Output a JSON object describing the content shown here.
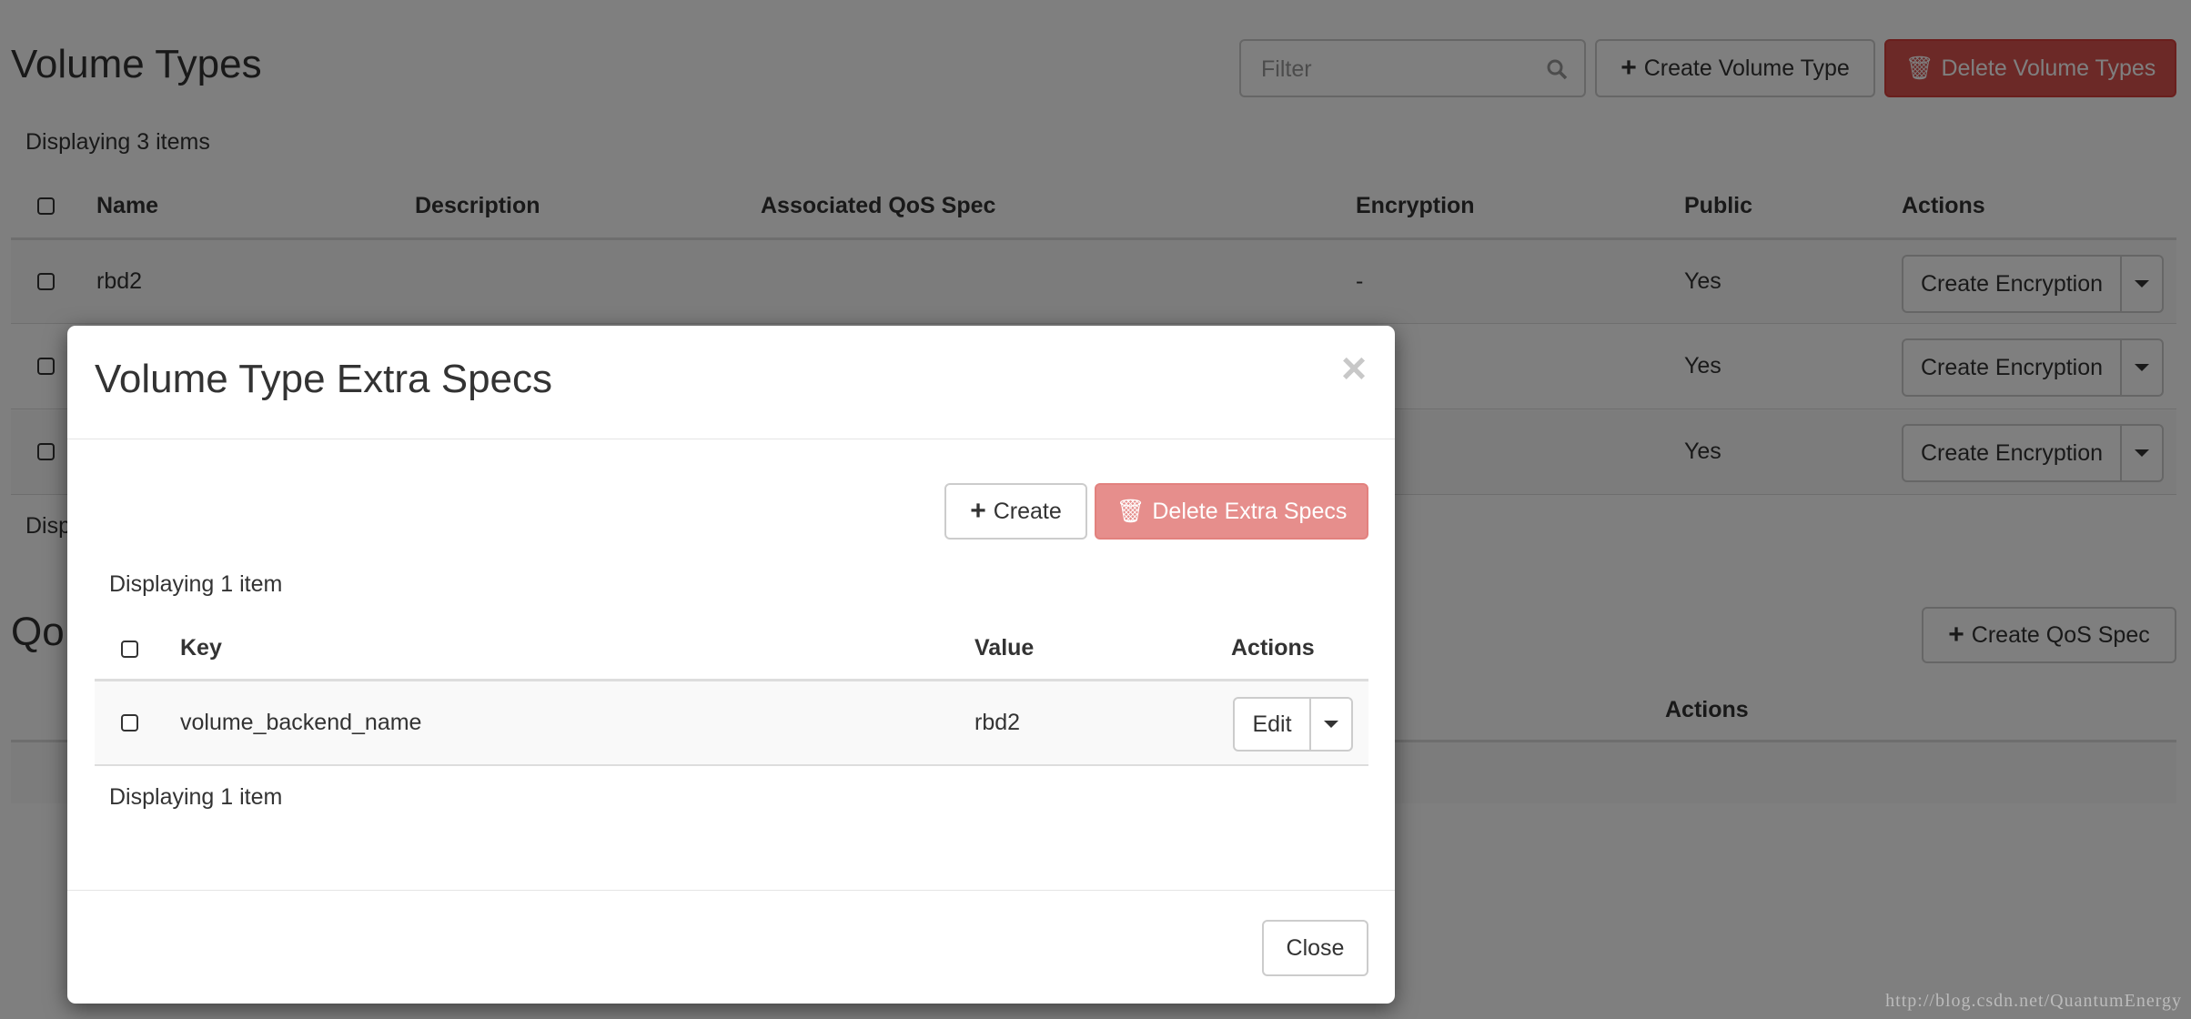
{
  "page": {
    "title": "Volume Types",
    "filter_placeholder": "Filter",
    "create_button": "Create Volume Type",
    "delete_button": "Delete Volume Types",
    "count_top": "Displaying 3 items",
    "count_bottom": "Disp",
    "columns": [
      "Name",
      "Description",
      "Associated QoS Spec",
      "Encryption",
      "Public",
      "Actions"
    ],
    "rows": [
      {
        "name": "rbd2",
        "description": "",
        "qos": "",
        "encryption": "-",
        "public": "Yes",
        "action": "Create Encryption"
      },
      {
        "name": "",
        "description": "",
        "qos": "",
        "encryption": "",
        "public": "Yes",
        "action": "Create Encryption"
      },
      {
        "name": "",
        "description": "",
        "qos": "",
        "encryption": "",
        "public": "Yes",
        "action": "Create Encryption"
      }
    ]
  },
  "qos": {
    "title_partial": "Qo",
    "create_button": "Create QoS Spec",
    "actions_header": "Actions"
  },
  "modal": {
    "title": "Volume Type Extra Specs",
    "close_icon": "×",
    "create_button": "Create",
    "delete_button": "Delete Extra Specs",
    "count_top": "Displaying 1 item",
    "columns": [
      "Key",
      "Value",
      "Actions"
    ],
    "rows": [
      {
        "key": "volume_backend_name",
        "value": "rbd2",
        "action": "Edit"
      }
    ],
    "count_bottom": "Displaying 1 item",
    "footer_close": "Close"
  },
  "watermark": "http://blog.csdn.net/QuantumEnergy",
  "colors": {
    "danger": "#d9534f",
    "backdrop": "rgba(0,0,0,0.5)"
  }
}
